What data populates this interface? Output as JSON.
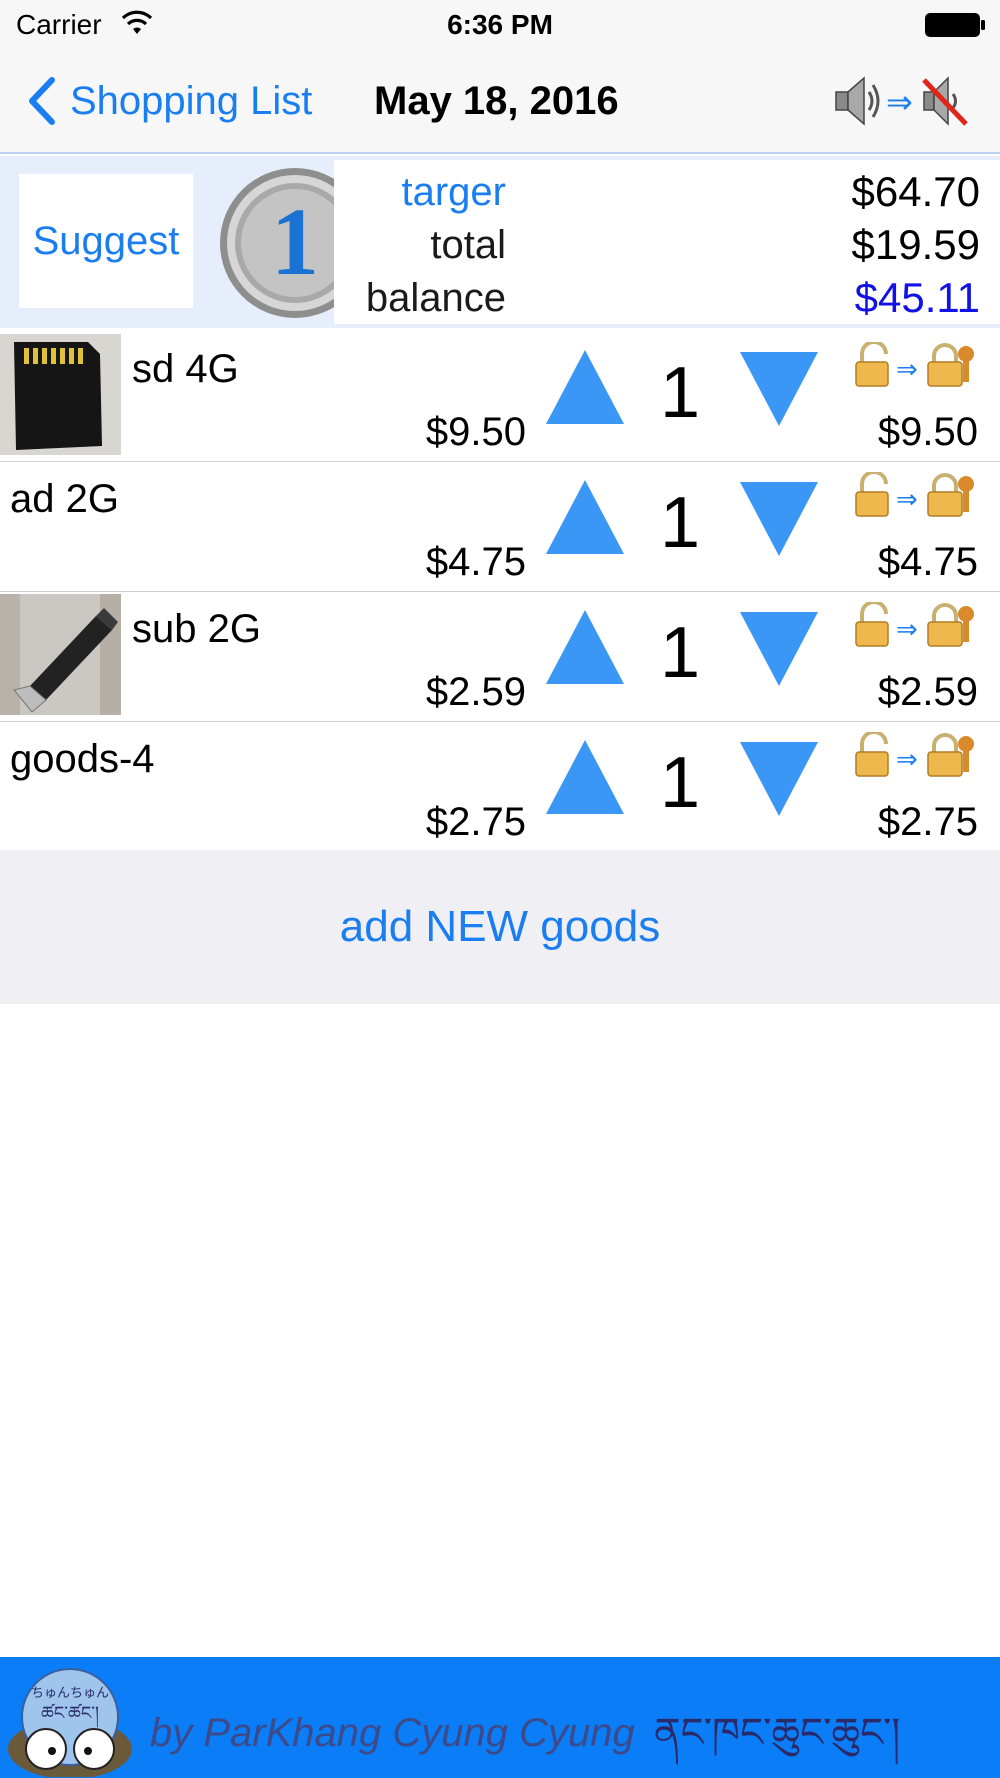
{
  "status_bar": {
    "carrier": "Carrier",
    "time": "6:36 PM"
  },
  "nav": {
    "back_label": "Shopping List",
    "title": "May 18, 2016",
    "sound_toggle_icon": "speaker-to-muted-icon"
  },
  "summary": {
    "suggest_label": "Suggest",
    "badge_icon": "coin-1-badge",
    "target_label": "targer",
    "target_value": "$64.70",
    "total_label": "total",
    "total_value": "$19.59",
    "balance_label": "balance",
    "balance_value": "$45.11"
  },
  "items": [
    {
      "name": "sd 4G",
      "price": "$9.50",
      "quantity": "1",
      "total": "$9.50",
      "thumbnail": "sd-card"
    },
    {
      "name": "ad 2G",
      "price": "$4.75",
      "quantity": "1",
      "total": "$4.75",
      "thumbnail": ""
    },
    {
      "name": "sub 2G",
      "price": "$2.59",
      "quantity": "1",
      "total": "$2.59",
      "thumbnail": "usb-stick"
    },
    {
      "name": "goods-4",
      "price": "$2.75",
      "quantity": "1",
      "total": "$2.75",
      "thumbnail": ""
    }
  ],
  "add_button_label": "add NEW goods",
  "footer": {
    "credit": "by ParKhang Cyung Cyung",
    "tibetan": "ནང་ཁང་ཆུང་ཆུང་།",
    "logo_text": "ちゅんちゅん"
  },
  "colors": {
    "accent": "#1a7ef0",
    "arrow_blue": "#3b97f5",
    "balance_blue": "#1212e6",
    "footer_bg": "#0a7df7",
    "summary_bg": "#e6eefb"
  }
}
